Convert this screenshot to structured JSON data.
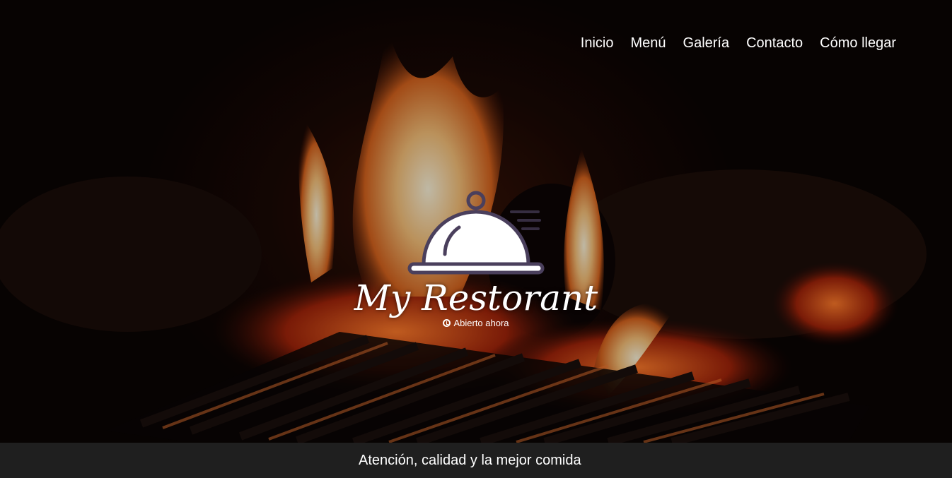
{
  "nav": {
    "items": [
      {
        "label": "Inicio"
      },
      {
        "label": "Menú"
      },
      {
        "label": "Galería"
      },
      {
        "label": "Contacto"
      },
      {
        "label": "Cómo llegar"
      }
    ]
  },
  "brand": {
    "logo_icon": "cloche-icon",
    "title": "My Restorant",
    "status_icon": "clock-icon",
    "status": "Abierto ahora"
  },
  "tagline": "Atención, calidad y la mejor comida",
  "colors": {
    "footer_bg": "#1f1f1f",
    "text": "#ffffff",
    "fire": "#f6a04a"
  }
}
